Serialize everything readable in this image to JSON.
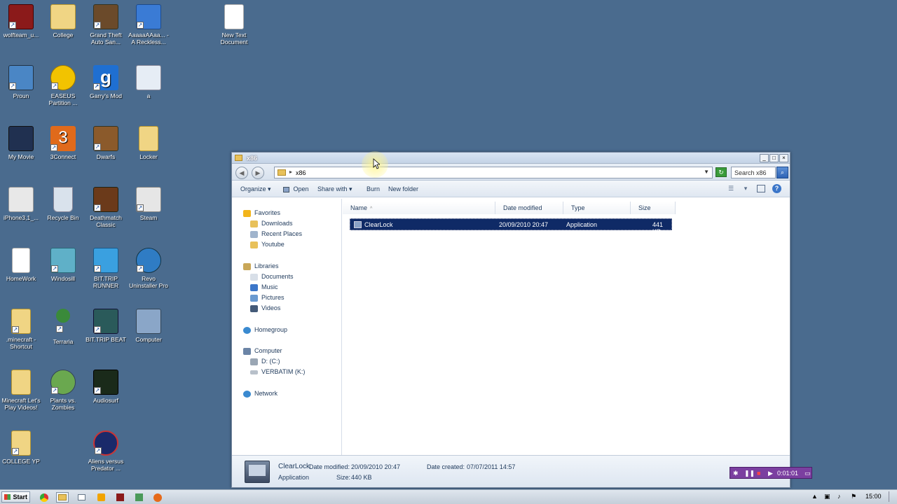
{
  "desktop": {
    "icons": [
      {
        "label": "wolfteam_u...",
        "icon": "wolfteam-icon",
        "color": "#8b1a1a"
      },
      {
        "label": "College",
        "icon": "folder-icon",
        "color": "#f0d584"
      },
      {
        "label": "Grand Theft Auto San...",
        "icon": "gta-icon",
        "color": "#6b4a2a"
      },
      {
        "label": "AaaaaAAaa... - A Reckless...",
        "icon": "aaaa-icon",
        "color": "#3a7bd5"
      },
      {
        "label": "New Text Document",
        "icon": "text-document-icon",
        "color": "#ffffff"
      },
      {
        "label": "Proun",
        "icon": "proun-icon",
        "color": "#4a86c5"
      },
      {
        "label": "EASEUS Partition ...",
        "icon": "easeus-icon",
        "color": "#f2c300"
      },
      {
        "label": "Garry's Mod",
        "icon": "garrys-mod-icon",
        "color": "#1f6fd1"
      },
      {
        "label": "a",
        "icon": "settings-file-icon",
        "color": "#e6edf5"
      },
      {
        "label": "My Movie",
        "icon": "movie-icon",
        "color": "#203050"
      },
      {
        "label": "3Connect",
        "icon": "3connect-icon",
        "color": "#e06a1b"
      },
      {
        "label": "Dwarfs",
        "icon": "dwarfs-icon",
        "color": "#8b5a2b"
      },
      {
        "label": "Locker",
        "icon": "folder-icon",
        "color": "#f0d584"
      },
      {
        "label": "iPhone3,1_...",
        "icon": "ipsw-icon",
        "color": "#e8e8e8"
      },
      {
        "label": "Recycle Bin",
        "icon": "recycle-bin-icon",
        "color": "#d9e2ec"
      },
      {
        "label": "Deathmatch Classic",
        "icon": "deathmatch-icon",
        "color": "#6b3a1a"
      },
      {
        "label": "Steam",
        "icon": "steam-icon",
        "color": "#e6e6e6"
      },
      {
        "label": "HomeWork",
        "icon": "document-icon",
        "color": "#ffffff"
      },
      {
        "label": "Windosill",
        "icon": "windosill-icon",
        "color": "#5fb0c8"
      },
      {
        "label": "BIT.TRIP RUNNER",
        "icon": "bittrip-runner-icon",
        "color": "#3aa0e0"
      },
      {
        "label": "Revo Uninstaller Pro",
        "icon": "revo-icon",
        "color": "#2f7cc4"
      },
      {
        "label": ".minecraft - Shortcut",
        "icon": "folder-icon",
        "color": "#f0d584"
      },
      {
        "label": "Terraria",
        "icon": "terraria-icon",
        "color": "#3a8a3a"
      },
      {
        "label": "BIT.TRIP BEAT",
        "icon": "bittrip-beat-icon",
        "color": "#2a5a5a"
      },
      {
        "label": "Computer",
        "icon": "computer-icon",
        "color": "#8aa6c8"
      },
      {
        "label": "Minecraft Let's Play Videos!",
        "icon": "folder-icon",
        "color": "#f0d584"
      },
      {
        "label": "Plants vs. Zombies",
        "icon": "pvz-icon",
        "color": "#6aa84f"
      },
      {
        "label": "Audiosurf",
        "icon": "audiosurf-icon",
        "color": "#1a2a1a"
      },
      {
        "label": "COLLEGE YP",
        "icon": "folder-icon",
        "color": "#f0d584"
      },
      {
        "label": "Aliens versus Predator ...",
        "icon": "avp-icon",
        "color": "#1a2a6a"
      }
    ]
  },
  "window": {
    "title": "x86",
    "address_path": "x86",
    "search_placeholder": "Search x86",
    "controls": {
      "minimize": "_",
      "maximize": "□",
      "close": "×"
    },
    "toolbar": {
      "organize": "Organize",
      "open": "Open",
      "share_with": "Share with",
      "burn": "Burn",
      "new_folder": "New folder"
    },
    "nav": {
      "favorites": "Favorites",
      "downloads": "Downloads",
      "recent_places": "Recent Places",
      "youtube": "Youtube",
      "libraries": "Libraries",
      "documents": "Documents",
      "music": "Music",
      "pictures": "Pictures",
      "videos": "Videos",
      "homegroup": "Homegroup",
      "computer": "Computer",
      "drive_d": "D: (C:)",
      "drive_k": "VERBATIM (K:)",
      "network": "Network"
    },
    "columns": {
      "name": "Name",
      "date_modified": "Date modified",
      "type": "Type",
      "size": "Size"
    },
    "files": [
      {
        "name": "ClearLock",
        "date_modified": "20/09/2010 20:47",
        "type": "Application",
        "size": "441 KB"
      }
    ],
    "details": {
      "name": "ClearLock",
      "date_modified_label": "Date modified:",
      "date_modified": "20/09/2010 20:47",
      "date_created_label": "Date created:",
      "date_created": "07/07/2011 14:57",
      "type": "Application",
      "size_label": "Size:",
      "size": "440 KB"
    }
  },
  "recorder": {
    "time": "0:01:01"
  },
  "taskbar": {
    "start_label": "Start",
    "clock": "15:00"
  },
  "colors": {
    "desktop_bg": "#4a6b8e",
    "selection": "#0f2a66",
    "recorder": "#7b3fa0"
  }
}
